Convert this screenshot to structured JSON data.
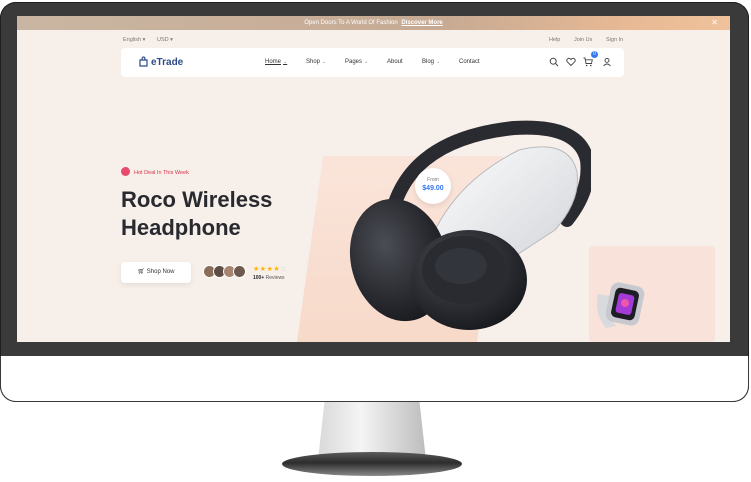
{
  "promo": {
    "text": "Open Doors To A World Of Fashion",
    "link": "Discover More"
  },
  "topbar": {
    "language": "English",
    "currency": "USD",
    "help": "Help",
    "join": "Join Us",
    "signin": "Sign In"
  },
  "nav": {
    "logo": "eTrade",
    "items": [
      {
        "label": "Home"
      },
      {
        "label": "Shop"
      },
      {
        "label": "Pages"
      },
      {
        "label": "About"
      },
      {
        "label": "Blog"
      },
      {
        "label": "Contact"
      }
    ],
    "cart_count": "0"
  },
  "hero": {
    "tagline": "Hot Deal In This Week",
    "title_line1": "Roco Wireless",
    "title_line2": "Headphone",
    "button": "Shop Now",
    "rating": 4,
    "reviews_count": "100+",
    "reviews_label": "Reviews",
    "price_label": "From",
    "price_value": "$49.00"
  },
  "colors": {
    "accent": "#3577f0",
    "brand": "#2d4a8a",
    "hot": "#d8334a",
    "background": "#f7efe9"
  }
}
